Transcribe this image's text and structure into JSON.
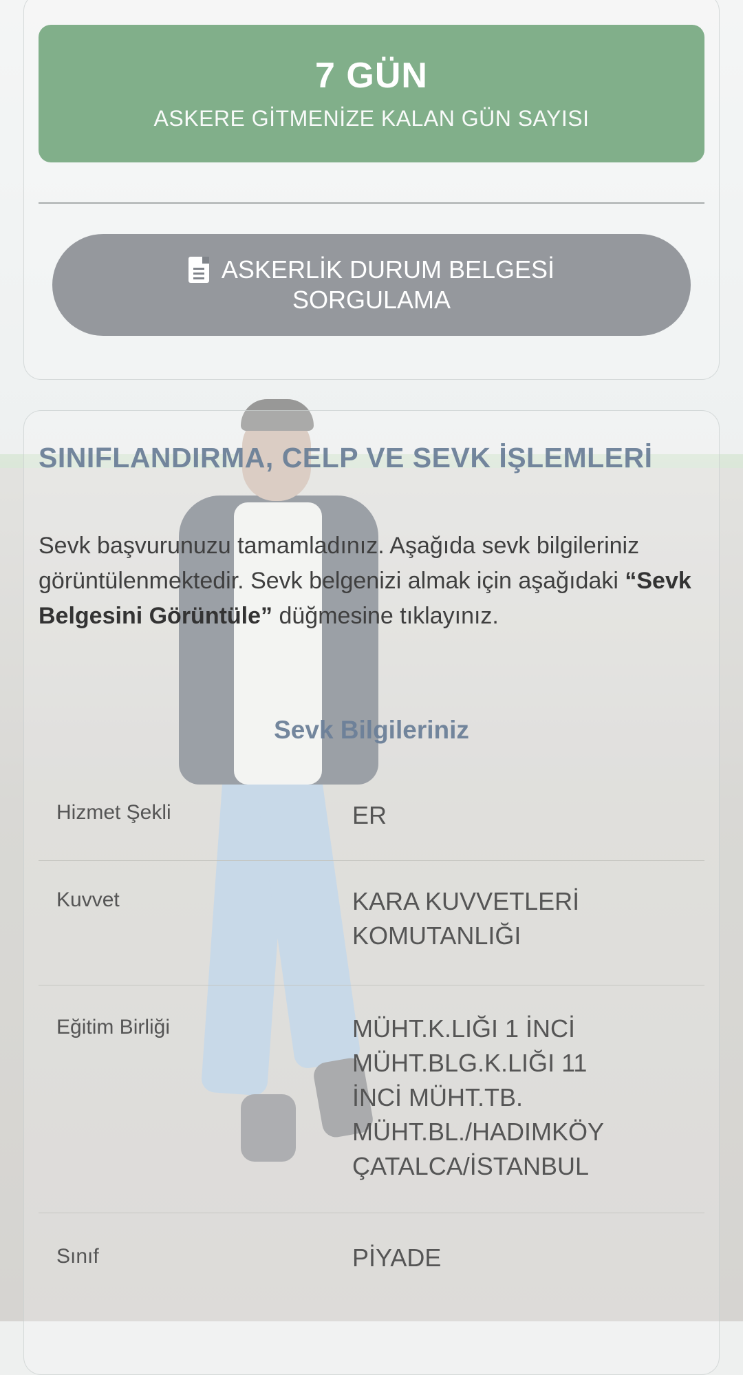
{
  "countdown": {
    "days": "7 GÜN",
    "label": "ASKERE GİTMENİZE KALAN GÜN SAYISI"
  },
  "query_button": {
    "line1": "ASKERLİK DURUM BELGESİ",
    "line2": "SORGULAMA",
    "icon": "document-icon"
  },
  "section": {
    "title": "SINIFLANDIRMA, CELP VE SEVK İŞLEMLERİ",
    "intro_before": "Sevk başvurunuzu tamamladınız. Aşağıda sevk bilgileriniz görüntülenmektedir. Sevk belgenizi almak için aşağıdaki ",
    "intro_bold": "“Sevk Belgesini Görüntüle”",
    "intro_after": " düğmesine tıklayınız.",
    "subtitle": "Sevk Bilgileriniz"
  },
  "info_rows": [
    {
      "key": "Hizmet Şekli",
      "value": "ER"
    },
    {
      "key": "Kuvvet",
      "value_lines": [
        "KARA KUVVETLERİ",
        "KOMUTANLIĞI"
      ]
    },
    {
      "key": "Eğitim Birliği",
      "value_lines": [
        "MÜHT.K.LIĞI 1 İNCİ",
        "MÜHT.BLG.K.LIĞI 11",
        "İNCİ MÜHT.TB.",
        "MÜHT.BL./HADIMKÖY",
        "ÇATALCA/İSTANBUL"
      ]
    },
    {
      "key": "Sınıf",
      "value": "PİYADE"
    }
  ],
  "colors": {
    "countdown_bg": "#76a880",
    "button_bg": "#80848a",
    "title_color": "#6c8098"
  }
}
